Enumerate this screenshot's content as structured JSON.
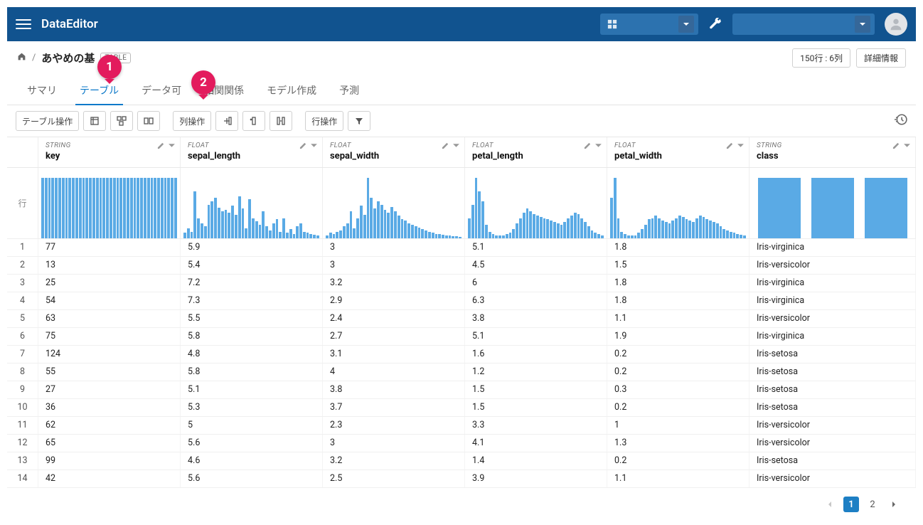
{
  "app": {
    "title": "DataEditor"
  },
  "breadcrumb": {
    "title": "あやめの基",
    "badge": "TABLE"
  },
  "meta": {
    "shape": "150行 : 6列",
    "details": "詳細情報"
  },
  "tabs": [
    {
      "label": "サマリ"
    },
    {
      "label": "テーブル"
    },
    {
      "label": "データ可"
    },
    {
      "label": "相関関係"
    },
    {
      "label": "モデル作成"
    },
    {
      "label": "予測"
    }
  ],
  "toolbar": {
    "table_ops": "テーブル操作",
    "col_ops": "列操作",
    "row_ops": "行操作"
  },
  "row_header": "行",
  "columns": [
    {
      "dtype": "STRING",
      "name": "key"
    },
    {
      "dtype": "FLOAT",
      "name": "sepal_length"
    },
    {
      "dtype": "FLOAT",
      "name": "sepal_width"
    },
    {
      "dtype": "FLOAT",
      "name": "petal_length"
    },
    {
      "dtype": "FLOAT",
      "name": "petal_width"
    },
    {
      "dtype": "STRING",
      "name": "class"
    }
  ],
  "histograms": {
    "key": [
      90,
      90,
      90,
      90,
      90,
      90,
      90,
      90,
      90,
      90,
      90,
      90,
      90,
      90,
      90,
      90,
      90,
      90,
      90,
      90,
      90,
      90,
      90,
      90,
      90,
      90,
      90,
      90,
      90,
      90,
      90,
      90,
      90,
      90,
      90,
      90,
      90,
      90,
      90,
      90
    ],
    "sepal_length": [
      8,
      15,
      10,
      70,
      30,
      22,
      18,
      50,
      55,
      60,
      45,
      40,
      42,
      38,
      48,
      35,
      62,
      44,
      15,
      58,
      30,
      25,
      20,
      40,
      18,
      12,
      22,
      28,
      10,
      30,
      8,
      14,
      6,
      18,
      22,
      10,
      8,
      6,
      5,
      4
    ],
    "sepal_width": [
      4,
      8,
      6,
      10,
      12,
      18,
      22,
      40,
      15,
      30,
      48,
      35,
      90,
      60,
      44,
      55,
      50,
      42,
      38,
      46,
      40,
      34,
      28,
      26,
      22,
      20,
      18,
      16,
      14,
      12,
      10,
      8,
      6,
      6,
      5,
      4,
      4,
      3,
      3,
      2
    ],
    "petal_length": [
      30,
      50,
      90,
      70,
      55,
      20,
      10,
      6,
      4,
      4,
      4,
      6,
      8,
      14,
      22,
      30,
      38,
      44,
      40,
      36,
      34,
      32,
      30,
      28,
      26,
      24,
      22,
      20,
      24,
      30,
      34,
      38,
      36,
      30,
      24,
      18,
      12,
      8,
      6,
      4
    ],
    "petal_width": [
      60,
      90,
      30,
      10,
      6,
      4,
      4,
      4,
      8,
      14,
      20,
      28,
      30,
      34,
      30,
      26,
      24,
      22,
      26,
      30,
      34,
      32,
      28,
      26,
      24,
      30,
      34,
      32,
      28,
      26,
      24,
      22,
      18,
      14,
      12,
      10,
      8,
      6,
      5,
      4
    ],
    "class": [
      90,
      90,
      90
    ]
  },
  "rows": [
    {
      "n": "1",
      "key": "77",
      "sepal_length": "5.9",
      "sepal_width": "3",
      "petal_length": "5.1",
      "petal_width": "1.8",
      "class": "Iris-virginica"
    },
    {
      "n": "2",
      "key": "13",
      "sepal_length": "5.4",
      "sepal_width": "3",
      "petal_length": "4.5",
      "petal_width": "1.5",
      "class": "Iris-versicolor"
    },
    {
      "n": "3",
      "key": "25",
      "sepal_length": "7.2",
      "sepal_width": "3.2",
      "petal_length": "6",
      "petal_width": "1.8",
      "class": "Iris-virginica"
    },
    {
      "n": "4",
      "key": "54",
      "sepal_length": "7.3",
      "sepal_width": "2.9",
      "petal_length": "6.3",
      "petal_width": "1.8",
      "class": "Iris-virginica"
    },
    {
      "n": "5",
      "key": "63",
      "sepal_length": "5.5",
      "sepal_width": "2.4",
      "petal_length": "3.8",
      "petal_width": "1.1",
      "class": "Iris-versicolor"
    },
    {
      "n": "6",
      "key": "75",
      "sepal_length": "5.8",
      "sepal_width": "2.7",
      "petal_length": "5.1",
      "petal_width": "1.9",
      "class": "Iris-virginica"
    },
    {
      "n": "7",
      "key": "124",
      "sepal_length": "4.8",
      "sepal_width": "3.1",
      "petal_length": "1.6",
      "petal_width": "0.2",
      "class": "Iris-setosa"
    },
    {
      "n": "8",
      "key": "55",
      "sepal_length": "5.8",
      "sepal_width": "4",
      "petal_length": "1.2",
      "petal_width": "0.2",
      "class": "Iris-setosa"
    },
    {
      "n": "9",
      "key": "27",
      "sepal_length": "5.1",
      "sepal_width": "3.8",
      "petal_length": "1.5",
      "petal_width": "0.3",
      "class": "Iris-setosa"
    },
    {
      "n": "10",
      "key": "36",
      "sepal_length": "5.3",
      "sepal_width": "3.7",
      "petal_length": "1.5",
      "petal_width": "0.2",
      "class": "Iris-setosa"
    },
    {
      "n": "11",
      "key": "62",
      "sepal_length": "5",
      "sepal_width": "2.3",
      "petal_length": "3.3",
      "petal_width": "1",
      "class": "Iris-versicolor"
    },
    {
      "n": "12",
      "key": "65",
      "sepal_length": "5.6",
      "sepal_width": "3",
      "petal_length": "4.1",
      "petal_width": "1.3",
      "class": "Iris-versicolor"
    },
    {
      "n": "13",
      "key": "99",
      "sepal_length": "4.6",
      "sepal_width": "3.2",
      "petal_length": "1.4",
      "petal_width": "0.2",
      "class": "Iris-setosa"
    },
    {
      "n": "14",
      "key": "42",
      "sepal_length": "5.6",
      "sepal_width": "2.5",
      "petal_length": "3.9",
      "petal_width": "1.1",
      "class": "Iris-versicolor"
    }
  ],
  "pagination": {
    "current": "1",
    "other": "2"
  },
  "markers": {
    "m1": "1",
    "m2": "2"
  }
}
